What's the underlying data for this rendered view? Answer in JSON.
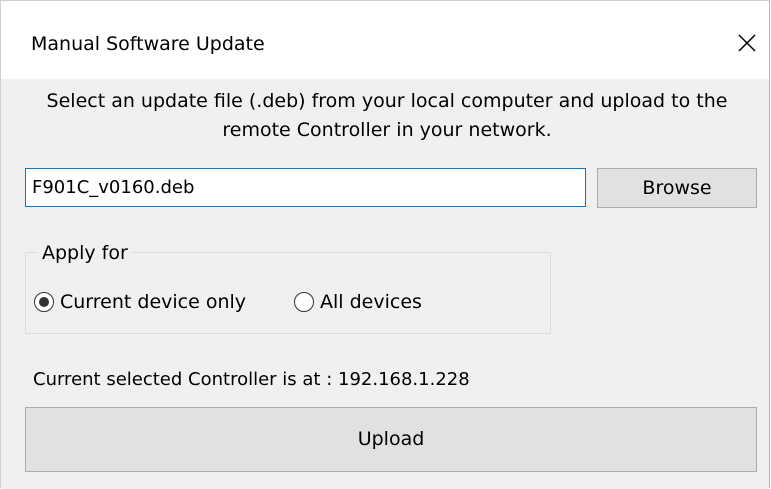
{
  "window": {
    "title": "Manual Software Update",
    "close_icon": "close-icon"
  },
  "description": "Select an update file (.deb) from your local computer and upload to the remote Controller in your network.",
  "file_input": {
    "value": "F901C_v0160.deb"
  },
  "browse_label": "Browse",
  "apply_group": {
    "legend": "Apply for",
    "options": [
      {
        "label": "Current device only",
        "selected": true
      },
      {
        "label": "All devices",
        "selected": false
      }
    ]
  },
  "controller_info": "Current selected Controller is at : 192.168.1.228",
  "upload_label": "Upload",
  "colors": {
    "focus_border": "#0078d7",
    "button_face": "#e1e1e1",
    "dialog_background": "#f0f0f0"
  }
}
